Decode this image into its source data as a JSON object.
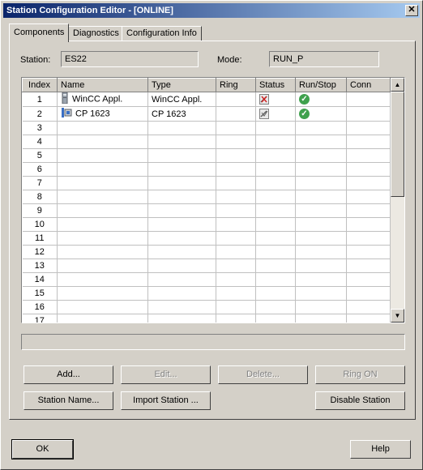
{
  "window": {
    "title": "Station Configuration Editor - [ONLINE]",
    "close_glyph": "✕"
  },
  "tabs": [
    {
      "label": "Components"
    },
    {
      "label": "Diagnostics"
    },
    {
      "label": "Configuration Info"
    }
  ],
  "station": {
    "label": "Station:",
    "value": "ES22"
  },
  "mode": {
    "label": "Mode:",
    "value": "RUN_P"
  },
  "grid": {
    "columns": [
      "Index",
      "Name",
      "Type",
      "Ring",
      "Status",
      "Run/Stop",
      "Conn"
    ],
    "rows": [
      {
        "index": "1",
        "name": "WinCC Appl.",
        "type": "WinCC Appl.",
        "ring": "",
        "status_icon": "status-fault-icon",
        "runstop_icon": "run-ok-icon",
        "name_icon": "pc-station-icon"
      },
      {
        "index": "2",
        "name": "CP 1623",
        "type": "CP 1623",
        "ring": "",
        "status_icon": "status-ok-icon",
        "runstop_icon": "run-ok-icon",
        "name_icon": "network-card-icon"
      },
      {
        "index": "3"
      },
      {
        "index": "4"
      },
      {
        "index": "5"
      },
      {
        "index": "6"
      },
      {
        "index": "7"
      },
      {
        "index": "8"
      },
      {
        "index": "9"
      },
      {
        "index": "10"
      },
      {
        "index": "11"
      },
      {
        "index": "12"
      },
      {
        "index": "13"
      },
      {
        "index": "14"
      },
      {
        "index": "15"
      },
      {
        "index": "16"
      },
      {
        "index": "17"
      }
    ]
  },
  "buttons": {
    "add": "Add...",
    "edit": "Edit...",
    "delete": "Delete...",
    "ring_on": "Ring ON",
    "station_name": "Station Name...",
    "import_station": "Import Station ...",
    "disable_station": "Disable Station",
    "ok": "OK",
    "help": "Help"
  },
  "colors": {
    "run_ok": "#3fa14d",
    "title_start": "#0a246a",
    "title_end": "#a6caf0"
  }
}
